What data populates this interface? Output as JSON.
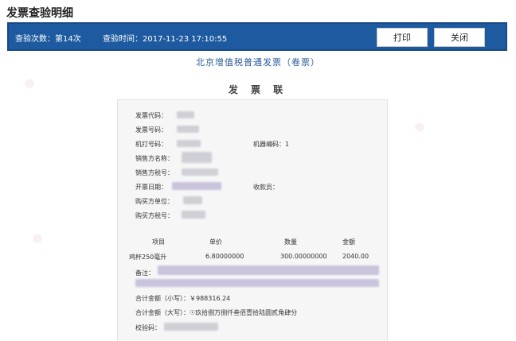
{
  "page": {
    "title": "发票查验明细"
  },
  "header": {
    "check_count": "查验次数：第14次",
    "check_time": "查验时间：2017-11-23 17:10:55",
    "print_label": "打印",
    "close_label": "关闭",
    "bar_color": "#1e5aa0"
  },
  "invoice": {
    "type_title": "北京增值税普通发票（卷票）",
    "copy_name": "发 票 联",
    "fields": {
      "invoice_code": "发票代码：",
      "invoice_number": "发票号码：",
      "machine_print_number": "机打号码：",
      "machine_code": "机器编码：1",
      "seller_name": "销售方名称：",
      "seller_tax_id": "销售方税号：",
      "issue_date": "开票日期：",
      "cashier": "收款员：",
      "buyer_unit": "购买方单位：",
      "buyer_tax_id": "购买方税号："
    },
    "table": {
      "headers": [
        "项目",
        "单价",
        "数量",
        "金额"
      ],
      "rows": [
        {
          "item": "鸡杯250毫升",
          "price": "6.80000000",
          "qty": "300.00000000",
          "amount": "2040.00"
        }
      ]
    },
    "remark_label": "备注：",
    "total_small": "合计金额（小写）：￥988316.24",
    "total_big": "合计金额（大写）：☉玖拾捌万捌仟叁佰壹拾陆圆贰角肆分",
    "check_code": "校验码："
  }
}
